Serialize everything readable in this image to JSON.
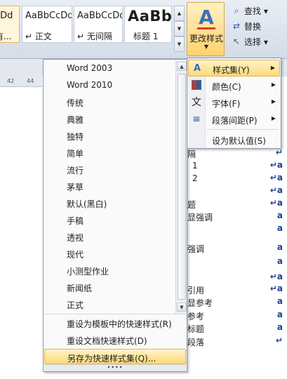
{
  "ribbon": {
    "style_tiles": [
      {
        "sample": "cDd",
        "label": "有..."
      },
      {
        "sample": "AaBbCcDd",
        "label": "↵ 正文"
      },
      {
        "sample": "AaBbCcDd",
        "label": "↵ 无间隔"
      },
      {
        "sample": "AaBb",
        "label": "标题 1"
      }
    ],
    "change_styles": {
      "label": "更改样式",
      "icon": "change-styles-icon"
    },
    "editing": [
      {
        "label": "查找 ▾",
        "icon": "find-icon"
      },
      {
        "label": "替换",
        "icon": "replace-icon"
      },
      {
        "label": "选择 ▾",
        "icon": "select-icon"
      }
    ]
  },
  "ruler": {
    "ticks": [
      "42",
      "44"
    ]
  },
  "style_set_menu": {
    "items": [
      "Word 2003",
      "Word 2010",
      "传统",
      "典雅",
      "独特",
      "简单",
      "流行",
      "茅草",
      "默认(黑白)",
      "手稿",
      "透视",
      "现代",
      "小测型作业",
      "新闻纸",
      "正式"
    ],
    "commands": [
      {
        "label": "重设为模板中的快速样式(R)",
        "highlight": false
      },
      {
        "label": "重设文档快速样式(D)",
        "highlight": false
      },
      {
        "label": "另存为快速样式集(Q)...",
        "highlight": true
      }
    ],
    "grip": "••••"
  },
  "change_styles_menu": {
    "items": [
      {
        "label": "样式集(Y)",
        "icon": "style-set-icon",
        "arrow": "▶",
        "highlight": true
      },
      {
        "label": "颜色(C)",
        "icon": "colors-icon",
        "arrow": "▶",
        "highlight": false
      },
      {
        "label": "字体(F)",
        "icon": "fonts-icon",
        "arrow": "▶",
        "highlight": false
      },
      {
        "label": "段落间距(P)",
        "icon": "paragraph-spacing-icon",
        "arrow": "▶",
        "highlight": false
      },
      {
        "label": "设为默认值(S)",
        "icon": "",
        "arrow": "",
        "highlight": false
      }
    ]
  },
  "styles_pane": {
    "rows": [
      {
        "text": "隔",
        "mark": "↵"
      },
      {
        "text": "1",
        "mark": "↵a"
      },
      {
        "text": "2",
        "mark": "↵a"
      },
      {
        "text": "",
        "mark": "↵a"
      },
      {
        "text": "题",
        "mark": "↵a"
      },
      {
        "text": "显强调",
        "mark": "a"
      },
      {
        "text": "",
        "mark": "a"
      },
      {
        "text": "强调",
        "mark": "a"
      },
      {
        "text": "",
        "mark": "a"
      },
      {
        "text": "",
        "mark": "↵a"
      },
      {
        "text": "引用",
        "mark": "↵a"
      },
      {
        "text": "显参考",
        "mark": "a"
      },
      {
        "text": "参考",
        "mark": "a"
      },
      {
        "text": "标题",
        "mark": "a"
      },
      {
        "text": "段落",
        "mark": "↵"
      }
    ]
  },
  "colors": {
    "accent_hover": "#ffd978",
    "menu_border": "#8a96a8",
    "link_blue": "#1f3f8f"
  }
}
